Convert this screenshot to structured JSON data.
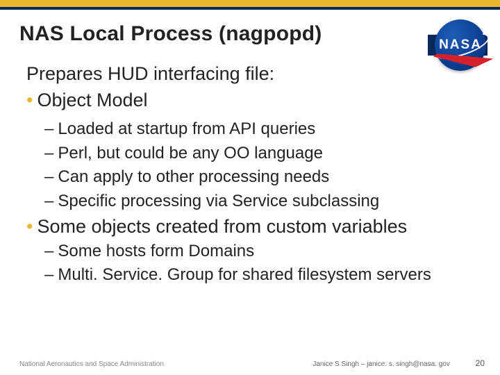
{
  "title": "NAS Local Process (nagpopd)",
  "logo": {
    "text": "NASA"
  },
  "lead": "Prepares HUD interfacing file:",
  "items": [
    {
      "level": 1,
      "text": "Object Model"
    },
    {
      "level": 2,
      "text": "Loaded at startup from API queries"
    },
    {
      "level": 2,
      "text": "Perl, but could be any OO language"
    },
    {
      "level": 2,
      "text": "Can apply to other processing needs"
    },
    {
      "level": 2,
      "text": "Specific processing via Service subclassing"
    },
    {
      "level": 1,
      "text": "Some objects created from custom variables"
    },
    {
      "level": 2,
      "text": "Some hosts form Domains"
    },
    {
      "level": 2,
      "text": "Multi. Service. Group for shared filesystem servers"
    }
  ],
  "footer": {
    "org": "National Aeronautics and Space Administration",
    "author": "Janice S Singh – janice. s. singh@nasa. gov",
    "page": "20"
  }
}
